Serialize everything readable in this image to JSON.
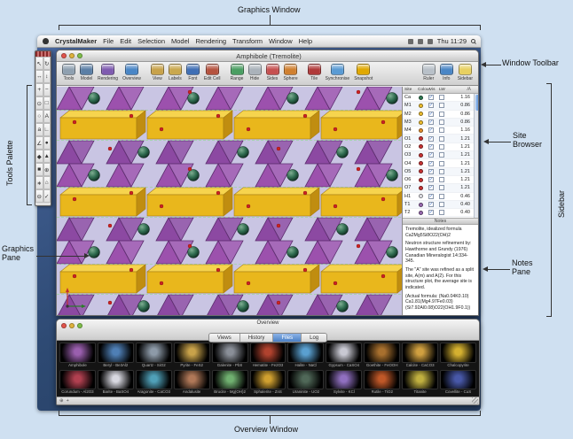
{
  "annotations": {
    "graphics_window": "Graphics Window",
    "window_toolbar": "Window Toolbar",
    "tools_palette": "Tools Palette",
    "site_browser_1": "Site",
    "site_browser_2": "Browser",
    "sidebar": "Sidebar",
    "graphics_pane_1": "Graphics",
    "graphics_pane_2": "Pane",
    "notes_pane_1": "Notes",
    "notes_pane_2": "Pane",
    "overview_window": "Overview Window"
  },
  "menubar": {
    "app_name": "CrystalMaker",
    "menus": [
      "File",
      "Edit",
      "Selection",
      "Model",
      "Rendering",
      "Transform",
      "Window",
      "Help"
    ],
    "clock": "Thu 11:29"
  },
  "window": {
    "title": "Amphibole (Tremolite)"
  },
  "toolbar": {
    "groups": [
      [
        {
          "label": "Tools",
          "icon": "tools",
          "color": "#8fa0b0"
        },
        {
          "label": "Model",
          "icon": "model",
          "color": "#5b7fa6"
        },
        {
          "label": "Rendering",
          "icon": "rendering",
          "color": "#7f5bb0"
        },
        {
          "label": "Overview",
          "icon": "overview",
          "color": "#4a86c6"
        }
      ],
      [
        {
          "label": "View",
          "icon": "view",
          "color": "#c8a24a"
        },
        {
          "label": "Labels",
          "icon": "labels",
          "color": "#caa84e"
        },
        {
          "label": "Font",
          "icon": "font",
          "color": "#3f6fb5"
        },
        {
          "label": "Edit Cell",
          "icon": "edit-cell",
          "color": "#b5533f"
        }
      ],
      [
        {
          "label": "Range",
          "icon": "range",
          "color": "#4a9e62"
        },
        {
          "label": "Hide",
          "icon": "hide",
          "color": "#aab2ba"
        },
        {
          "label": "Sides",
          "icon": "sides",
          "color": "#c65050"
        },
        {
          "label": "Sphere",
          "icon": "sphere",
          "color": "#d08030"
        }
      ],
      [
        {
          "label": "Tile",
          "icon": "tile",
          "color": "#b03a3a"
        },
        {
          "label": "Synchronise",
          "icon": "synchronise",
          "color": "#5a9bd4"
        },
        {
          "label": "Snapshot",
          "icon": "snapshot",
          "color": "#e0a800"
        }
      ]
    ],
    "right": [
      {
        "label": "Ruler",
        "icon": "ruler",
        "color": "#b8c0c8"
      },
      {
        "label": "Info",
        "icon": "info",
        "color": "#4a86c6"
      },
      {
        "label": "Sidebar",
        "icon": "sidebar-toggle",
        "color": "#e8d060"
      }
    ]
  },
  "palette": {
    "tools": [
      {
        "name": "select",
        "glyph": "↖"
      },
      {
        "name": "rotate",
        "glyph": "↻"
      },
      {
        "name": "pan",
        "glyph": "↔"
      },
      {
        "name": "slide",
        "glyph": "↕"
      },
      {
        "name": "zoom-in",
        "glyph": "+"
      },
      {
        "name": "zoom-out",
        "glyph": "−"
      },
      {
        "name": "spin",
        "glyph": "⊙"
      },
      {
        "name": "marquee",
        "glyph": "□"
      },
      {
        "name": "lasso",
        "glyph": "○"
      },
      {
        "name": "label",
        "glyph": "A"
      },
      {
        "name": "text",
        "glyph": "a"
      },
      {
        "name": "distance",
        "glyph": "∟"
      },
      {
        "name": "angle",
        "glyph": "∠"
      },
      {
        "name": "atoms",
        "glyph": "●"
      },
      {
        "name": "bonds",
        "glyph": "◆"
      },
      {
        "name": "polyhedra",
        "glyph": "▲"
      },
      {
        "name": "cell",
        "glyph": "■"
      },
      {
        "name": "origin",
        "glyph": "⊕"
      },
      {
        "name": "axes",
        "glyph": "∗"
      },
      {
        "name": "home",
        "glyph": "⌂"
      },
      {
        "name": "hide-tool",
        "glyph": "⊖"
      },
      {
        "name": "apply",
        "glyph": "✓"
      }
    ]
  },
  "site_browser": {
    "columns": [
      "Site",
      "Colour",
      "Vis",
      "LW",
      "/Å"
    ],
    "rows": [
      {
        "site": "Ca",
        "color": "#2f7a52",
        "vis": true,
        "lw": false,
        "radius": "1.16"
      },
      {
        "site": "M1",
        "color": "#f2c12e",
        "vis": true,
        "lw": false,
        "radius": "0.86"
      },
      {
        "site": "M2",
        "color": "#f2c12e",
        "vis": true,
        "lw": false,
        "radius": "0.86"
      },
      {
        "site": "M3",
        "color": "#f2c12e",
        "vis": true,
        "lw": false,
        "radius": "0.86"
      },
      {
        "site": "M4",
        "color": "#e8922e",
        "vis": true,
        "lw": false,
        "radius": "1.16"
      },
      {
        "site": "O1",
        "color": "#cc3333",
        "vis": true,
        "lw": false,
        "radius": "1.21"
      },
      {
        "site": "O2",
        "color": "#cc3333",
        "vis": true,
        "lw": false,
        "radius": "1.21"
      },
      {
        "site": "O3",
        "color": "#cc3333",
        "vis": true,
        "lw": false,
        "radius": "1.21"
      },
      {
        "site": "O4",
        "color": "#cc3333",
        "vis": true,
        "lw": false,
        "radius": "1.21"
      },
      {
        "site": "O5",
        "color": "#cc3333",
        "vis": true,
        "lw": false,
        "radius": "1.21"
      },
      {
        "site": "O6",
        "color": "#cc3333",
        "vis": true,
        "lw": false,
        "radius": "1.21"
      },
      {
        "site": "O7",
        "color": "#cc3333",
        "vis": true,
        "lw": false,
        "radius": "1.21"
      },
      {
        "site": "H1",
        "color": "#e4e4ea",
        "vis": true,
        "lw": false,
        "radius": "0.46"
      },
      {
        "site": "T1",
        "color": "#9b6bb3",
        "vis": true,
        "lw": false,
        "radius": "0.40"
      },
      {
        "site": "T2",
        "color": "#9b6bb3",
        "vis": true,
        "lw": false,
        "radius": "0.40"
      }
    ]
  },
  "notes": {
    "header": "Notes",
    "paragraphs": [
      "Tremolite, idealized formula Ca2Mg5Si8O22(OH)2",
      "Neutron structure refinement by: Hawthorne and Grundy (1976) Canadian Mineralogist 14:334-345.",
      "The \"A\" site was refined as a split site, A(m) and A(2). For this structure plot, the average site is indicated.",
      "(Actual formula: (Na0.04K0.10) Ca1.81(Mg4.97Fe0.03) (Si7.92Al0.08)O22(OH1.9F0.1))"
    ]
  },
  "overview": {
    "title": "Overview",
    "tabs": [
      {
        "label": "Views",
        "active": false
      },
      {
        "label": "History",
        "active": false
      },
      {
        "label": "Files",
        "active": true
      },
      {
        "label": "Log",
        "active": false
      }
    ],
    "rows": [
      [
        {
          "name": "Amphibole",
          "color": "#9a5fae"
        },
        {
          "name": "Beryl - Be3Al2",
          "color": "#4f7fb5"
        },
        {
          "name": "Quartz - SiO2",
          "color": "#8d9aa8"
        },
        {
          "name": "Pyrite - FeS2",
          "color": "#c8a24a"
        },
        {
          "name": "Galenite - PbS",
          "color": "#8a8f98"
        },
        {
          "name": "Hematite - Fe2O3",
          "color": "#b0422e"
        },
        {
          "name": "Halite - NaCl",
          "color": "#5aa0d0"
        },
        {
          "name": "Gypsum - CaSO4",
          "color": "#c8c8d2"
        },
        {
          "name": "Goethite - FeOOH",
          "color": "#a8702e"
        },
        {
          "name": "Calcite - CaCO3",
          "color": "#d0a040"
        },
        {
          "name": "Chalcopyrite",
          "color": "#d4b030"
        }
      ],
      [
        {
          "name": "Corundum - Al2O3",
          "color": "#b04050"
        },
        {
          "name": "Barite - BaSO4",
          "color": "#d8d8e0"
        },
        {
          "name": "Aragonite - CaCO3",
          "color": "#50a0b8"
        },
        {
          "name": "Andalusite",
          "color": "#b07858"
        },
        {
          "name": "Brucite - Mg(OH)2",
          "color": "#70b070"
        },
        {
          "name": "Sphalerite - ZnS",
          "color": "#d0a030"
        },
        {
          "name": "Uraninite - UO2",
          "color": "#506858"
        },
        {
          "name": "Sylvite - KCl",
          "color": "#9070c0"
        },
        {
          "name": "Rutile - TiO2",
          "color": "#c05828"
        },
        {
          "name": "Titanite",
          "color": "#c0b040"
        },
        {
          "name": "Covellite - CuS",
          "color": "#4858a8"
        }
      ]
    ],
    "status_icons": [
      {
        "name": "pan",
        "glyph": "⊕"
      },
      {
        "name": "zoom",
        "glyph": "+"
      }
    ]
  },
  "structure_colors": {
    "pane_background": "#c9c5e3",
    "tetrahedra_purple": "#9c51ad",
    "octahedra_yellow": "#e9b71c",
    "calcium_sphere_green": "#2e6b4f",
    "oxygen_red": "#cc2222",
    "cell_edge_green": "#9cd6a0",
    "desktop_blue": "#2d4972",
    "accent_blue": "#4a7fc4"
  }
}
